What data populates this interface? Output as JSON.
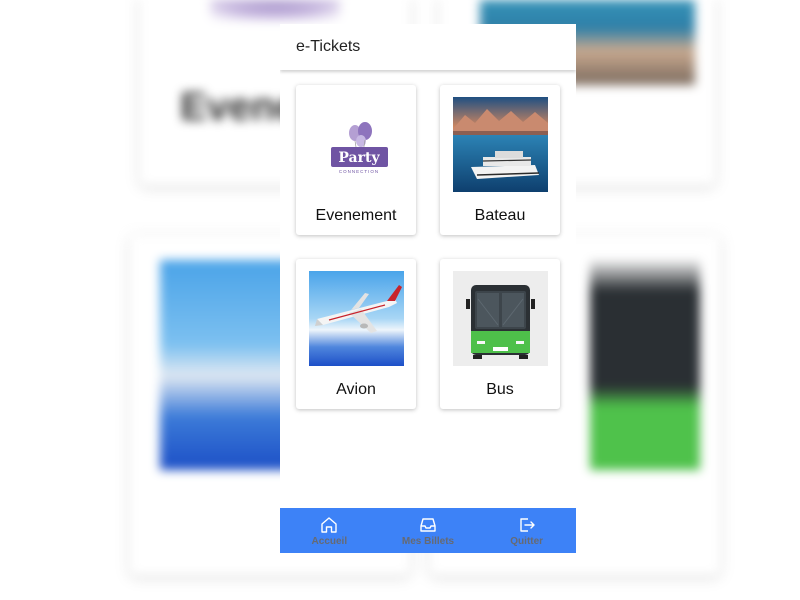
{
  "app": {
    "title": "e-Tickets"
  },
  "categories": [
    {
      "label": "Evenement",
      "image": "party-connection-logo",
      "logo_text": "Party",
      "logo_subtext": "CONNECTION"
    },
    {
      "label": "Bateau",
      "image": "ferry-photo"
    },
    {
      "label": "Avion",
      "image": "airplane-photo"
    },
    {
      "label": "Bus",
      "image": "green-bus-photo"
    }
  ],
  "tabbar": {
    "tabs": [
      {
        "label": "Accueil",
        "icon": "home-icon"
      },
      {
        "label": "Mes Billets",
        "icon": "inbox-icon"
      },
      {
        "label": "Quitter",
        "icon": "logout-icon"
      }
    ]
  },
  "colors": {
    "accent": "#3d82f7",
    "tab_label": "#666a73",
    "background": "#ffffff"
  }
}
